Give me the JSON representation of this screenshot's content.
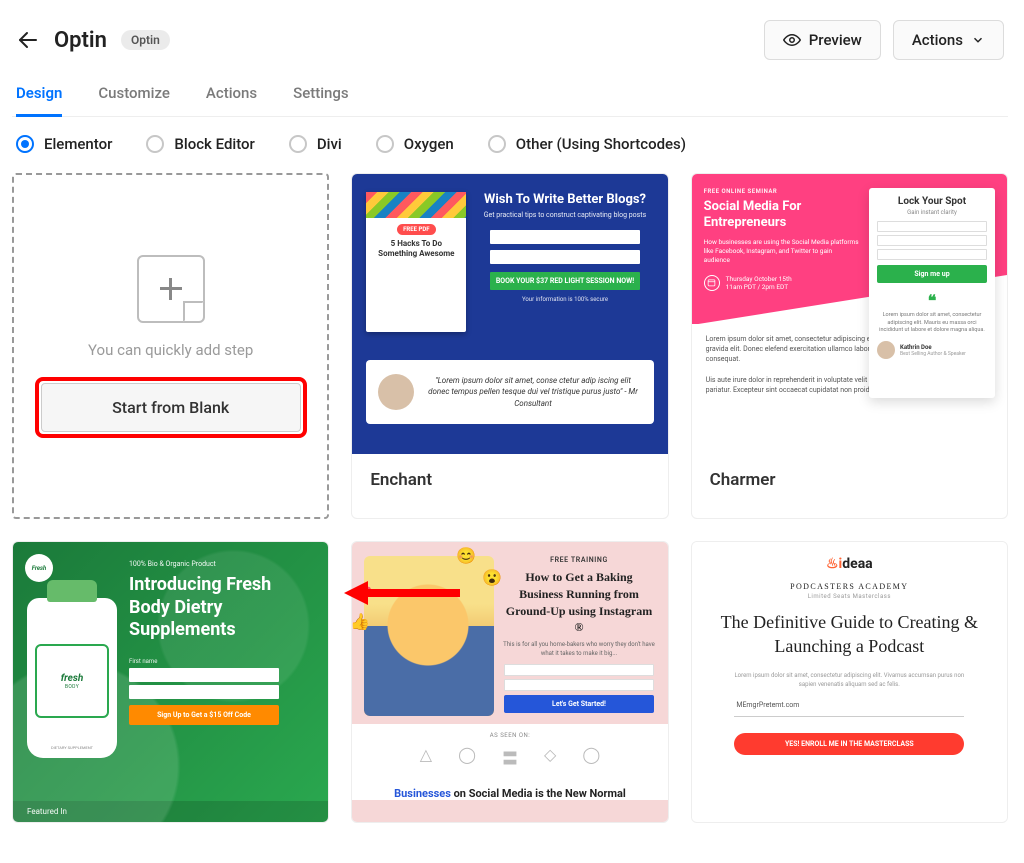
{
  "header": {
    "title": "Optin",
    "badge": "Optin",
    "preview_label": "Preview",
    "actions_label": "Actions"
  },
  "tabs": [
    {
      "label": "Design",
      "active": true
    },
    {
      "label": "Customize",
      "active": false
    },
    {
      "label": "Actions",
      "active": false
    },
    {
      "label": "Settings",
      "active": false
    }
  ],
  "editors": [
    {
      "label": "Elementor",
      "selected": true
    },
    {
      "label": "Block Editor",
      "selected": false
    },
    {
      "label": "Divi",
      "selected": false
    },
    {
      "label": "Oxygen",
      "selected": false
    },
    {
      "label": "Other (Using Shortcodes)",
      "selected": false
    }
  ],
  "blank_card": {
    "hint": "You can quickly add step",
    "button": "Start from Blank"
  },
  "templates": {
    "enchant": {
      "title": "Enchant",
      "book_pill": "FREE PDF",
      "book_title": "5 Hacks To Do Something Awesome",
      "headline": "Wish To Write Better Blogs?",
      "sub": "Get practical tips to construct captivating blog posts",
      "cta": "BOOK YOUR $37 RED LIGHT SESSION NOW!",
      "disclaimer": "Your information is 100% secure",
      "testimonial": "\"Lorem ipsum dolor sit amet, conse ctetur adip iscing elit donec tempus pellen tesque dui vel tristique purus justo\" - Mr Consultant"
    },
    "charmer": {
      "title": "Charmer",
      "tag": "FREE ONLINE SEMINAR",
      "headline": "Social Media For Entrepreneurs",
      "sub": "How businesses are using the Social Media platforms like Facebook, Instagram, and Twitter to gain audience",
      "date1": "Thursday October 15th",
      "date2": "11am PDT / 2pm EDT",
      "form_title": "Lock Your Spot",
      "form_sub": "Gain instant clarity",
      "cta": "Sign me up",
      "quote_text": "Lorem ipsum dolor sit amet, consectetur adipiscing elit. Mauris eu massa orci incididunt ut labore et dolore magna aliqua.",
      "person_name": "Kathrin Doe",
      "person_role": "Best Selling Author & Speaker",
      "body": "Lorem ipsum dolor sit amet, consectetur adipiscing elit. Praesent id dolor dui, dapibus gravida elit. Donec elefend exercitation ullamco laboris nisi ut aliquip ex ea commodo consequat.\n\nUis aute irure dolor in reprehenderit in voluptate velit esse cillum dolore eu fugiat nulla pariatur. Excepteur sint occaecat cupidatat non proident."
    },
    "fresh": {
      "badge": "Fresh",
      "tag": "100% Bio & Organic Product",
      "headline": "Introducing Fresh Body Dietry Supplements",
      "label_logo": "fresh",
      "label_sub": "BODY",
      "field_label": "First name",
      "cta": "Sign Up to Get a $15 Off Code",
      "footer": "Featured In"
    },
    "baking": {
      "tag": "FREE TRAINING",
      "headline": "How to Get a Baking Business Running from Ground-Up using Instagram ®",
      "sub": "This is for all you home-bakers who worry they don't have what it takes to make it big...",
      "cta": "Let's Get Started!",
      "seen": "AS SEEN ON:",
      "footer_pre": "Businesses",
      "footer_post": " on Social Media is the New Normal"
    },
    "ideaa": {
      "brand": "ideaa",
      "sub1": "PODCASTERS ACADEMY",
      "sub2": "Limited Seats Masterclass",
      "headline": "The Definitive Guide to Creating & Launching a Podcast",
      "lorem": "Lorem ipsum dolor sit amet, consectetur adipiscing elit. Vivamus accumsan purus non sapien venenatis aliquam sed ac felis.",
      "field_placeholder": "MEmgrPretemt.com",
      "cta": "YES! ENROLL ME IN THE MASTERCLASS"
    }
  }
}
